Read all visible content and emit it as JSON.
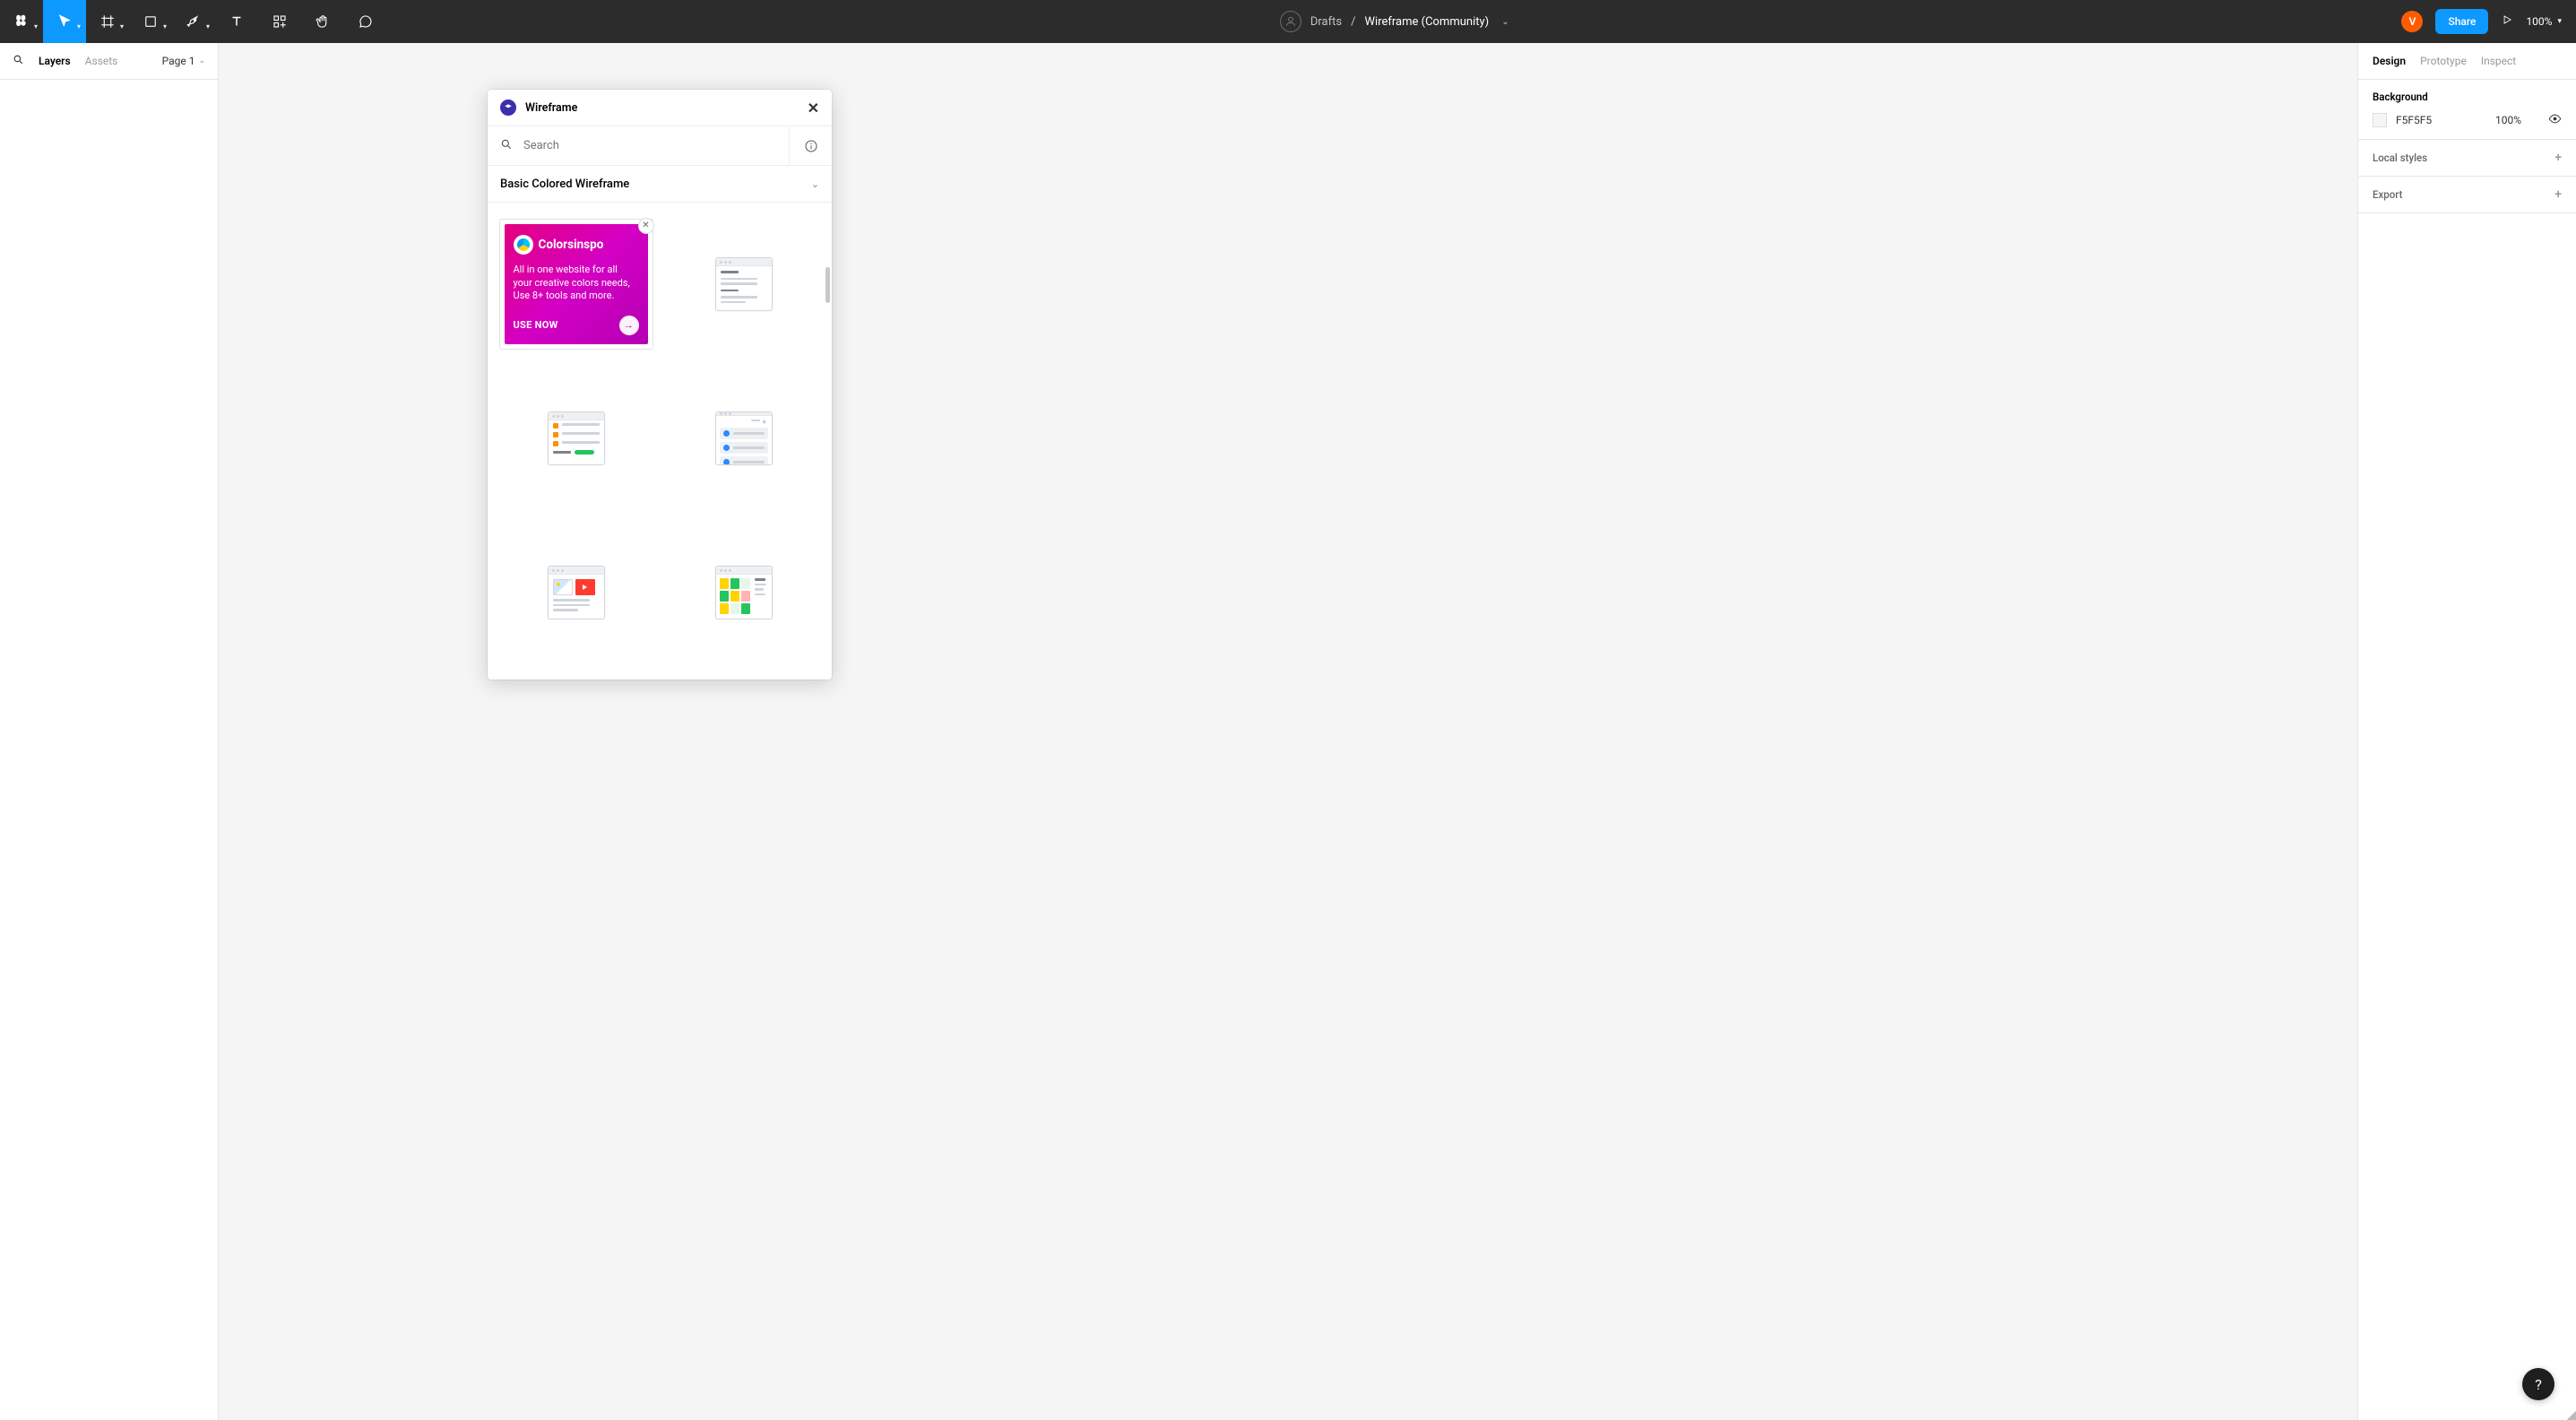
{
  "breadcrumb": {
    "root": "Drafts",
    "separator": "/",
    "doc": "Wireframe (Community)"
  },
  "toolbar": {
    "zoom_label": "100%",
    "share_label": "Share"
  },
  "user": {
    "initial": "V"
  },
  "left_panel": {
    "tabs": {
      "layers": "Layers",
      "assets": "Assets"
    },
    "page_label": "Page 1"
  },
  "right_panel": {
    "tabs": {
      "design": "Design",
      "prototype": "Prototype",
      "inspect": "Inspect"
    },
    "background": {
      "title": "Background",
      "hex": "F5F5F5",
      "opacity": "100%"
    },
    "local_styles": "Local styles",
    "export": "Export"
  },
  "assets_popover": {
    "title": "Wireframe",
    "search_placeholder": "Search",
    "section_title": "Basic Colored Wireframe",
    "promo": {
      "brand": "Colorsinspo",
      "copy": "All in one website for all your creative colors needs, Use 8+ tools and more.",
      "cta": "USE NOW"
    }
  }
}
